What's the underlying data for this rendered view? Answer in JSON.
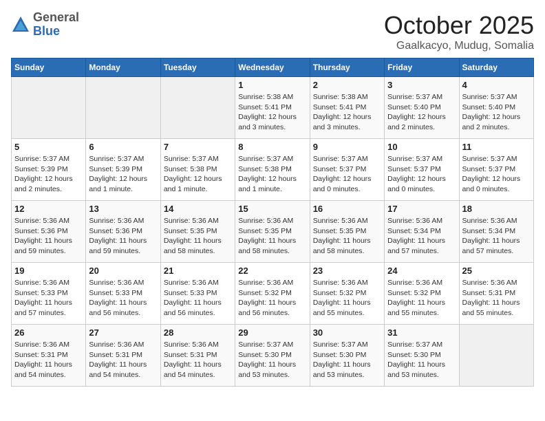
{
  "header": {
    "logo": {
      "general": "General",
      "blue": "Blue"
    },
    "month": "October 2025",
    "location": "Gaalkacyo, Mudug, Somalia"
  },
  "weekdays": [
    "Sunday",
    "Monday",
    "Tuesday",
    "Wednesday",
    "Thursday",
    "Friday",
    "Saturday"
  ],
  "weeks": [
    [
      {
        "day": "",
        "info": ""
      },
      {
        "day": "",
        "info": ""
      },
      {
        "day": "",
        "info": ""
      },
      {
        "day": "1",
        "info": "Sunrise: 5:38 AM\nSunset: 5:41 PM\nDaylight: 12 hours\nand 3 minutes."
      },
      {
        "day": "2",
        "info": "Sunrise: 5:38 AM\nSunset: 5:41 PM\nDaylight: 12 hours\nand 3 minutes."
      },
      {
        "day": "3",
        "info": "Sunrise: 5:37 AM\nSunset: 5:40 PM\nDaylight: 12 hours\nand 2 minutes."
      },
      {
        "day": "4",
        "info": "Sunrise: 5:37 AM\nSunset: 5:40 PM\nDaylight: 12 hours\nand 2 minutes."
      }
    ],
    [
      {
        "day": "5",
        "info": "Sunrise: 5:37 AM\nSunset: 5:39 PM\nDaylight: 12 hours\nand 2 minutes."
      },
      {
        "day": "6",
        "info": "Sunrise: 5:37 AM\nSunset: 5:39 PM\nDaylight: 12 hours\nand 1 minute."
      },
      {
        "day": "7",
        "info": "Sunrise: 5:37 AM\nSunset: 5:38 PM\nDaylight: 12 hours\nand 1 minute."
      },
      {
        "day": "8",
        "info": "Sunrise: 5:37 AM\nSunset: 5:38 PM\nDaylight: 12 hours\nand 1 minute."
      },
      {
        "day": "9",
        "info": "Sunrise: 5:37 AM\nSunset: 5:37 PM\nDaylight: 12 hours\nand 0 minutes."
      },
      {
        "day": "10",
        "info": "Sunrise: 5:37 AM\nSunset: 5:37 PM\nDaylight: 12 hours\nand 0 minutes."
      },
      {
        "day": "11",
        "info": "Sunrise: 5:37 AM\nSunset: 5:37 PM\nDaylight: 12 hours\nand 0 minutes."
      }
    ],
    [
      {
        "day": "12",
        "info": "Sunrise: 5:36 AM\nSunset: 5:36 PM\nDaylight: 11 hours\nand 59 minutes."
      },
      {
        "day": "13",
        "info": "Sunrise: 5:36 AM\nSunset: 5:36 PM\nDaylight: 11 hours\nand 59 minutes."
      },
      {
        "day": "14",
        "info": "Sunrise: 5:36 AM\nSunset: 5:35 PM\nDaylight: 11 hours\nand 58 minutes."
      },
      {
        "day": "15",
        "info": "Sunrise: 5:36 AM\nSunset: 5:35 PM\nDaylight: 11 hours\nand 58 minutes."
      },
      {
        "day": "16",
        "info": "Sunrise: 5:36 AM\nSunset: 5:35 PM\nDaylight: 11 hours\nand 58 minutes."
      },
      {
        "day": "17",
        "info": "Sunrise: 5:36 AM\nSunset: 5:34 PM\nDaylight: 11 hours\nand 57 minutes."
      },
      {
        "day": "18",
        "info": "Sunrise: 5:36 AM\nSunset: 5:34 PM\nDaylight: 11 hours\nand 57 minutes."
      }
    ],
    [
      {
        "day": "19",
        "info": "Sunrise: 5:36 AM\nSunset: 5:33 PM\nDaylight: 11 hours\nand 57 minutes."
      },
      {
        "day": "20",
        "info": "Sunrise: 5:36 AM\nSunset: 5:33 PM\nDaylight: 11 hours\nand 56 minutes."
      },
      {
        "day": "21",
        "info": "Sunrise: 5:36 AM\nSunset: 5:33 PM\nDaylight: 11 hours\nand 56 minutes."
      },
      {
        "day": "22",
        "info": "Sunrise: 5:36 AM\nSunset: 5:32 PM\nDaylight: 11 hours\nand 56 minutes."
      },
      {
        "day": "23",
        "info": "Sunrise: 5:36 AM\nSunset: 5:32 PM\nDaylight: 11 hours\nand 55 minutes."
      },
      {
        "day": "24",
        "info": "Sunrise: 5:36 AM\nSunset: 5:32 PM\nDaylight: 11 hours\nand 55 minutes."
      },
      {
        "day": "25",
        "info": "Sunrise: 5:36 AM\nSunset: 5:31 PM\nDaylight: 11 hours\nand 55 minutes."
      }
    ],
    [
      {
        "day": "26",
        "info": "Sunrise: 5:36 AM\nSunset: 5:31 PM\nDaylight: 11 hours\nand 54 minutes."
      },
      {
        "day": "27",
        "info": "Sunrise: 5:36 AM\nSunset: 5:31 PM\nDaylight: 11 hours\nand 54 minutes."
      },
      {
        "day": "28",
        "info": "Sunrise: 5:36 AM\nSunset: 5:31 PM\nDaylight: 11 hours\nand 54 minutes."
      },
      {
        "day": "29",
        "info": "Sunrise: 5:37 AM\nSunset: 5:30 PM\nDaylight: 11 hours\nand 53 minutes."
      },
      {
        "day": "30",
        "info": "Sunrise: 5:37 AM\nSunset: 5:30 PM\nDaylight: 11 hours\nand 53 minutes."
      },
      {
        "day": "31",
        "info": "Sunrise: 5:37 AM\nSunset: 5:30 PM\nDaylight: 11 hours\nand 53 minutes."
      },
      {
        "day": "",
        "info": ""
      }
    ]
  ]
}
